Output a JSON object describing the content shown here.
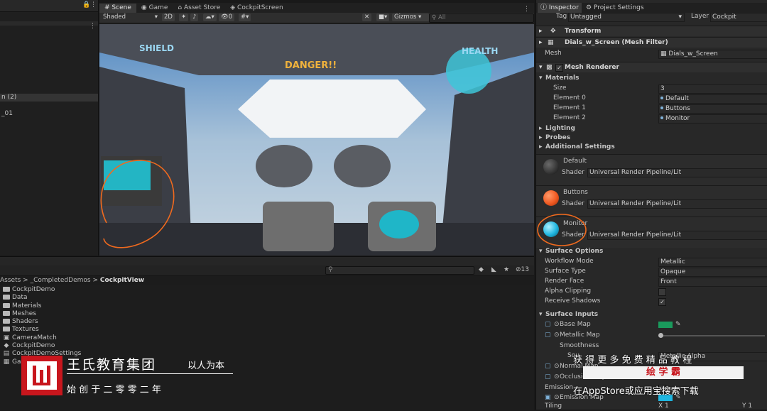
{
  "hierarchy": {
    "lock_icon": "lock-icon",
    "rows": [
      "n (2)",
      "_01"
    ]
  },
  "scene": {
    "tabs": [
      {
        "icon": "#",
        "label": "Scene"
      },
      {
        "icon": "◉",
        "label": "Game"
      },
      {
        "icon": "⌂",
        "label": "Asset Store"
      },
      {
        "icon": "◈",
        "label": "CockpitScreen"
      }
    ],
    "shading_mode": "Shaded",
    "mode_2d": "2D",
    "toolbar_counter": "0",
    "gizmos_label": "Gizmos",
    "search_placeholder": "All",
    "hud": {
      "shield": "SHIELD",
      "health": "HEALTH",
      "danger": "DANGER!!"
    }
  },
  "project": {
    "breadcrumb": [
      "Assets",
      "_CompletedDemos",
      "CockpitView"
    ],
    "hidden_count": "13",
    "items": [
      {
        "type": "folder",
        "label": "CockpitDemo"
      },
      {
        "type": "folder",
        "label": "Data"
      },
      {
        "type": "folder",
        "label": "Materials"
      },
      {
        "type": "folder",
        "label": "Meshes"
      },
      {
        "type": "folder",
        "label": "Shaders"
      },
      {
        "type": "folder",
        "label": "Textures"
      },
      {
        "type": "asset",
        "label": "CameraMatch"
      },
      {
        "type": "asset",
        "label": "CockpitDemo"
      },
      {
        "type": "asset",
        "label": "CockpitDemoSettings"
      },
      {
        "type": "asset",
        "label": "Gam"
      }
    ]
  },
  "inspector": {
    "tabs": [
      "Inspector",
      "Project Settings"
    ],
    "tag_label": "Tag",
    "tag_value": "Untagged",
    "layer_label": "Layer",
    "layer_value": "Cockpit",
    "transform_title": "Transform",
    "mesh_filter_title": "Dials_w_Screen (Mesh Filter)",
    "mesh_label": "Mesh",
    "mesh_value": "Dials_w_Screen",
    "mesh_renderer_title": "Mesh Renderer",
    "materials_title": "Materials",
    "size_label": "Size",
    "size_value": "3",
    "elements": [
      {
        "label": "Element 0",
        "value": "Default"
      },
      {
        "label": "Element 1",
        "value": "Buttons"
      },
      {
        "label": "Element 2",
        "value": "Monitor"
      }
    ],
    "sections": [
      "Lighting",
      "Probes",
      "Additional Settings"
    ],
    "shader_label": "Shader",
    "materials": [
      {
        "name": "Default",
        "shader": "Universal Render Pipeline/Lit",
        "color": "#2a2a2a"
      },
      {
        "name": "Buttons",
        "shader": "Universal Render Pipeline/Lit",
        "color": "#f05a22"
      },
      {
        "name": "Monitor",
        "shader": "Universal Render Pipeline/Lit",
        "color": "#1fb6e0"
      }
    ],
    "surface_options_title": "Surface Options",
    "surface_options": [
      {
        "label": "Workflow Mode",
        "value": "Metallic"
      },
      {
        "label": "Surface Type",
        "value": "Opaque"
      },
      {
        "label": "Render Face",
        "value": "Front"
      }
    ],
    "alpha_clipping_label": "Alpha Clipping",
    "receive_shadows_label": "Receive Shadows",
    "receive_shadows_check": "✓",
    "surface_inputs_title": "Surface Inputs",
    "base_map_label": "Base Map",
    "base_map_color": "#1a9a5c",
    "metallic_map_label": "Metallic Map",
    "smoothness_label": "Smoothness",
    "source_label": "Sou",
    "source_value": "Metallic Alpha",
    "normal_map_label": "Normal Map",
    "occlusion_map_label": "Occlusion Map",
    "emission_label": "Emission",
    "emission_map_label": "Emission Map",
    "emission_color": "#1fb6e0",
    "tiling_label": "Tiling",
    "tiling_x": "X 1",
    "tiling_y": "Y 1"
  },
  "overlay": {
    "brand_name": "王氏教育集团",
    "slogan": "以人为本",
    "founded": "始 创 于 二 零 零 二 年",
    "promo_top": "获 得 更 多 免 费 精 品 教 程",
    "promo_brand": "绘 学 霸",
    "promo_bottom": "在AppStore或应用宝搜索下载",
    "logo_color": "#c8161d"
  }
}
